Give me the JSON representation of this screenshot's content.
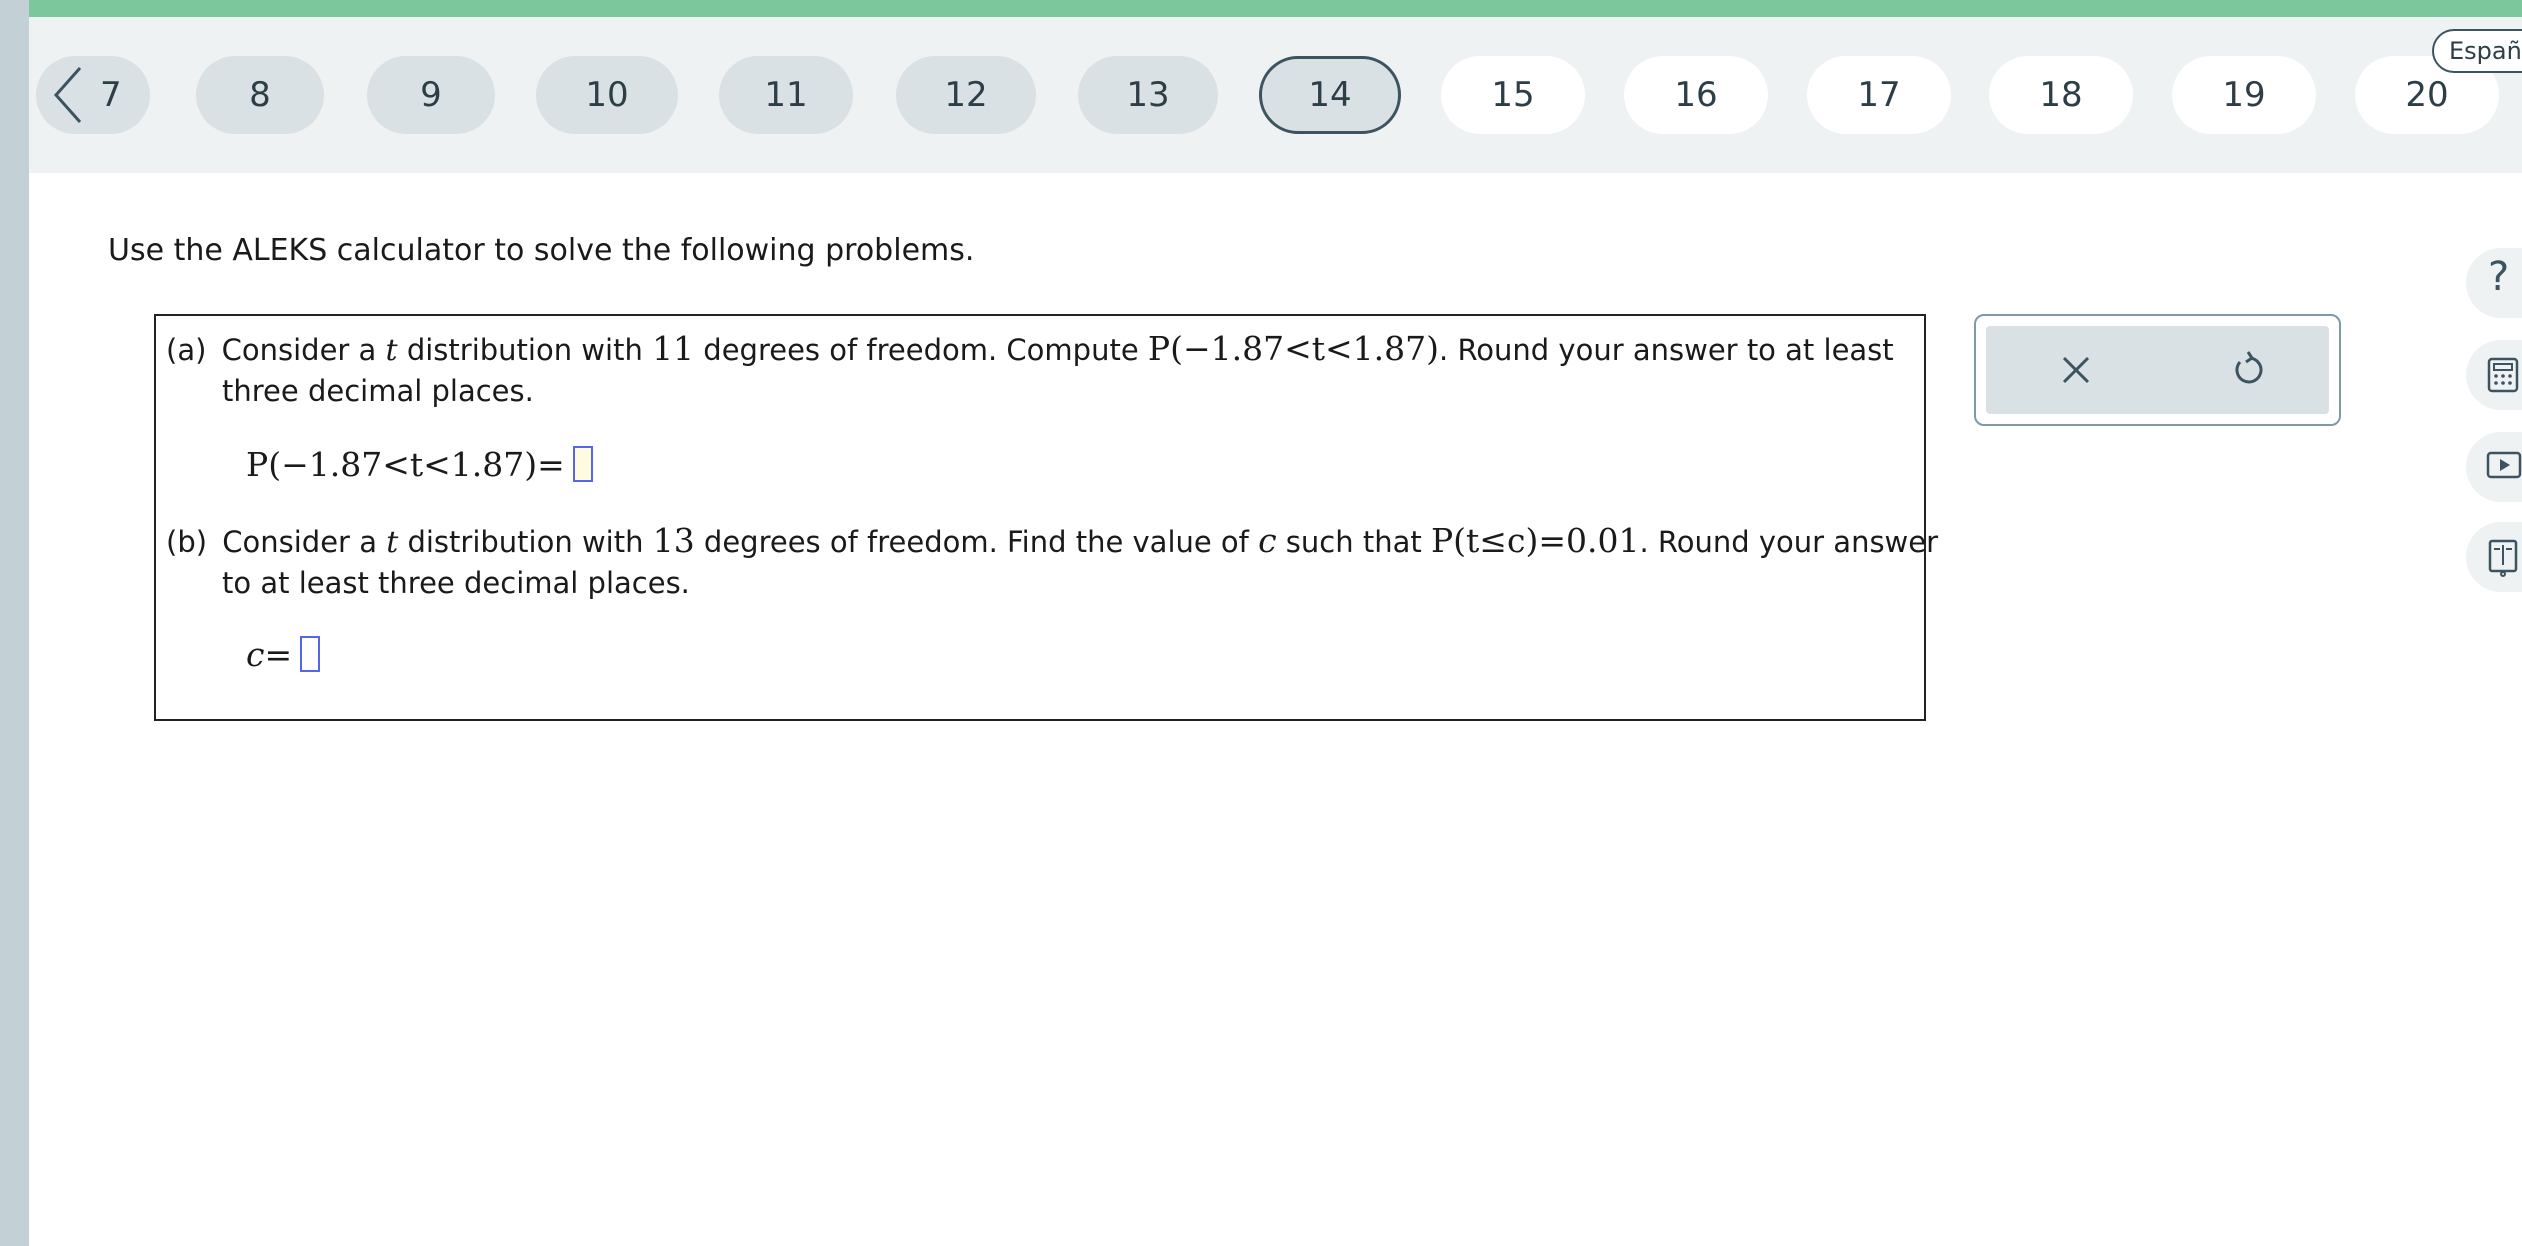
{
  "nav": {
    "back_number": "7",
    "questions": [
      {
        "label": "8",
        "state": "done"
      },
      {
        "label": "9",
        "state": "done"
      },
      {
        "label": "10",
        "state": "done"
      },
      {
        "label": "11",
        "state": "done"
      },
      {
        "label": "12",
        "state": "done"
      },
      {
        "label": "13",
        "state": "done"
      },
      {
        "label": "14",
        "state": "current"
      },
      {
        "label": "15",
        "state": "todo"
      },
      {
        "label": "16",
        "state": "todo"
      },
      {
        "label": "17",
        "state": "todo"
      },
      {
        "label": "18",
        "state": "todo"
      },
      {
        "label": "19",
        "state": "todo"
      },
      {
        "label": "20",
        "state": "todo"
      }
    ],
    "language_label": "Español"
  },
  "instruction": "Use the ALEKS calculator to solve the following problems.",
  "problem_a": {
    "tag": "(a)",
    "t1": "Consider a ",
    "tvar": "t",
    "t2": " distribution with ",
    "df": "11",
    "t3": " degrees of freedom. Compute ",
    "expr": "P(−1.87<t<1.87)",
    "t4": ". Round your answer to at least",
    "line2": "three decimal places."
  },
  "problem_b": {
    "tag": "(b)",
    "t1": "Consider a ",
    "tvar": "t",
    "t2": " distribution with ",
    "df": "13",
    "t3": " degrees of freedom. Find the value of ",
    "cvar": "c",
    "t4": " such that ",
    "expr": "P(t≤c)=0.01",
    "t5": ". Round your answer",
    "line2": "to at least three decimal places."
  },
  "icons": {
    "clear": "x-icon",
    "reset": "undo-icon",
    "help": "question-icon",
    "calculator": "calculator-icon",
    "video": "play-icon",
    "ebook": "book-icon"
  },
  "colors": {
    "accent_bar": "#7dc79c",
    "answer_border": "#5566ee",
    "pill_done": "#dae1e4",
    "pill_current_border": "#3c5360"
  }
}
